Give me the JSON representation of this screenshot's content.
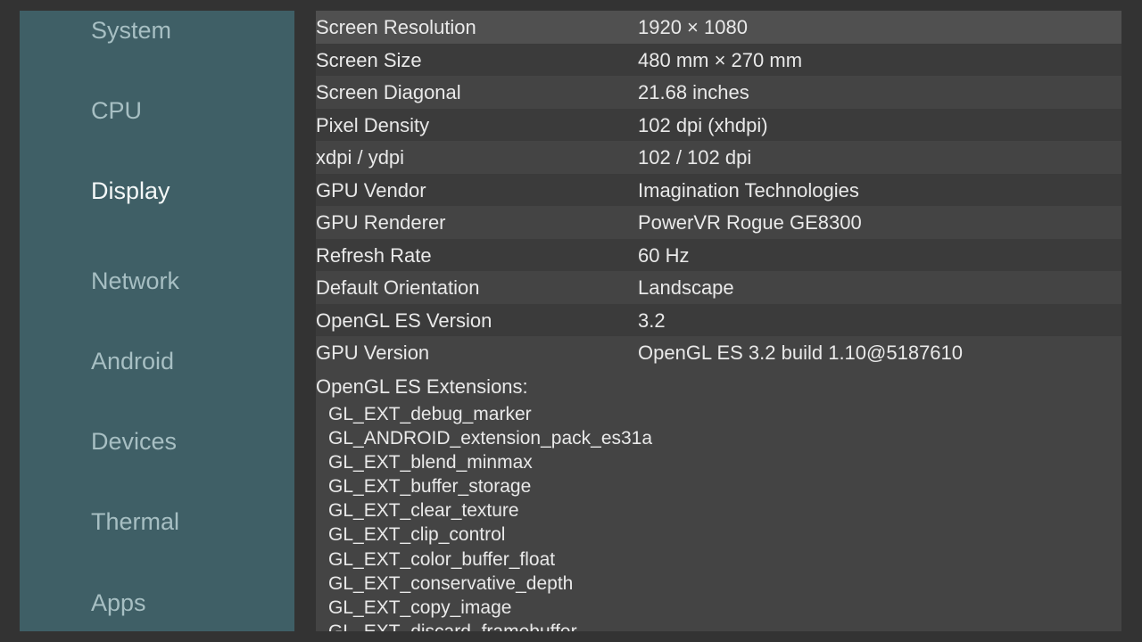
{
  "sidebar": {
    "items": [
      {
        "label": "System",
        "active": false
      },
      {
        "label": "CPU",
        "active": false
      },
      {
        "label": "Display",
        "active": true
      },
      {
        "label": "Network",
        "active": false
      },
      {
        "label": "Android",
        "active": false
      },
      {
        "label": "Devices",
        "active": false
      },
      {
        "label": "Thermal",
        "active": false
      },
      {
        "label": "Apps",
        "active": false
      }
    ]
  },
  "display": {
    "rows": [
      {
        "key": "Screen Resolution",
        "value": "1920 × 1080"
      },
      {
        "key": "Screen Size",
        "value": "480 mm × 270 mm"
      },
      {
        "key": "Screen Diagonal",
        "value": "21.68 inches"
      },
      {
        "key": "Pixel Density",
        "value": "102 dpi (xhdpi)"
      },
      {
        "key": "xdpi / ydpi",
        "value": "102 / 102 dpi"
      },
      {
        "key": "GPU Vendor",
        "value": "Imagination Technologies"
      },
      {
        "key": "GPU Renderer",
        "value": "PowerVR Rogue GE8300"
      },
      {
        "key": "Refresh Rate",
        "value": "60 Hz"
      },
      {
        "key": "Default Orientation",
        "value": "Landscape"
      },
      {
        "key": "OpenGL ES Version",
        "value": "3.2"
      },
      {
        "key": "GPU Version",
        "value": "OpenGL ES 3.2 build 1.10@5187610"
      }
    ],
    "extensions_title": "OpenGL ES Extensions:",
    "extensions": [
      "GL_EXT_debug_marker",
      "GL_ANDROID_extension_pack_es31a",
      "GL_EXT_blend_minmax",
      "GL_EXT_buffer_storage",
      "GL_EXT_clear_texture",
      "GL_EXT_clip_control",
      "GL_EXT_color_buffer_float",
      "GL_EXT_conservative_depth",
      "GL_EXT_copy_image",
      "GL_EXT_discard_framebuffer"
    ]
  },
  "colors": {
    "background": "#333333",
    "sidebar": "#3f5f66",
    "nav_text": "#a7bfc3",
    "nav_active_text": "#f4f8f8",
    "row_even": "#444444",
    "row_odd": "#3b3b3b",
    "row_highlight": "#505050",
    "text": "#e9e9e9"
  }
}
